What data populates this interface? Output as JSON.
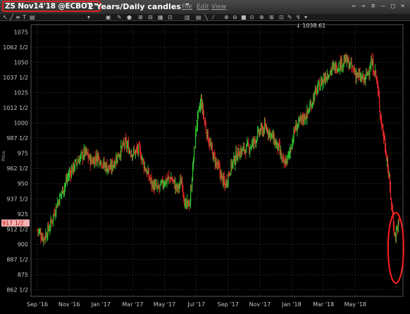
{
  "window": {
    "symbol": "ZS Nov14'18 @ECBOT",
    "period": "2 Years/Daily candles",
    "menus": [
      "File",
      "Edit",
      "View"
    ],
    "controls": [
      "←",
      "→",
      "≡",
      "—",
      "□",
      "×"
    ]
  },
  "toolbar": {
    "icons": [
      "cursor-icon",
      "line-tool-icon",
      "channel-tool-icon",
      "text-tool-icon",
      "fib-tool-icon",
      "snapshot-icon",
      "color-icon",
      "settings-icon",
      "indicator-icon",
      "compare-icon",
      "zoom-in-icon",
      "zoom-out-icon",
      "pan-icon",
      "crosshair-icon",
      "bar-type-icon",
      "layout-icon",
      "link-icon",
      "print-icon",
      "dropdown-icon"
    ]
  },
  "chart": {
    "y_label": "Price",
    "crosshair_readout": "1038.61",
    "last_price_label": "917 1/2",
    "colors": {
      "up": "#2ec02e",
      "down": "#e02828",
      "grid": "#3a3a3a",
      "last_price_bg": "#f3b3b3",
      "highlight": "#ff2020"
    }
  },
  "chart_data": {
    "type": "candlestick",
    "title": "ZS Nov14'18 @ECBOT",
    "xlabel": "",
    "ylabel": "Price",
    "y_ticks": [
      "1075",
      "1062 1/2",
      "1050",
      "1037 1/2",
      "1025",
      "1012 1/2",
      "1000",
      "987 1/2",
      "975",
      "962 1/2",
      "950",
      "937 1/2",
      "925",
      "912 1/2",
      "900",
      "887 1/2",
      "875",
      "862 1/2"
    ],
    "y_tick_values": [
      1075,
      1062.5,
      1050,
      1037.5,
      1025,
      1012.5,
      1000,
      987.5,
      975,
      962.5,
      950,
      937.5,
      925,
      912.5,
      900,
      887.5,
      875,
      862.5
    ],
    "ylim": [
      857,
      1081
    ],
    "x_ticks": [
      "Sep '16",
      "Nov '16",
      "Jan '17",
      "Mar '17",
      "May '17",
      "Jul '17",
      "Sep '17",
      "Nov '17",
      "Jan '18",
      "Mar '18",
      "May '18"
    ],
    "x_tick_months": [
      0,
      2,
      4,
      6,
      8,
      10,
      12,
      14,
      16,
      18,
      20
    ],
    "xlim_months": [
      -0.4,
      23.0
    ],
    "price_path": [
      [
        0.0,
        912
      ],
      [
        0.4,
        905
      ],
      [
        0.8,
        915
      ],
      [
        1.2,
        932
      ],
      [
        1.6,
        945
      ],
      [
        2.0,
        958
      ],
      [
        2.5,
        968
      ],
      [
        3.0,
        976
      ],
      [
        3.4,
        968
      ],
      [
        3.8,
        973
      ],
      [
        4.2,
        965
      ],
      [
        4.6,
        962
      ],
      [
        5.0,
        972
      ],
      [
        5.5,
        983
      ],
      [
        6.0,
        975
      ],
      [
        6.4,
        978
      ],
      [
        6.8,
        962
      ],
      [
        7.2,
        950
      ],
      [
        7.6,
        945
      ],
      [
        8.0,
        952
      ],
      [
        8.4,
        955
      ],
      [
        8.8,
        945
      ],
      [
        9.1,
        953
      ],
      [
        9.3,
        930
      ],
      [
        9.6,
        935
      ],
      [
        10.0,
        998
      ],
      [
        10.3,
        1018
      ],
      [
        10.6,
        995
      ],
      [
        11.0,
        975
      ],
      [
        11.4,
        962
      ],
      [
        11.8,
        948
      ],
      [
        12.2,
        965
      ],
      [
        12.6,
        975
      ],
      [
        13.0,
        978
      ],
      [
        13.5,
        982
      ],
      [
        14.0,
        993
      ],
      [
        14.4,
        996
      ],
      [
        14.8,
        988
      ],
      [
        15.2,
        978
      ],
      [
        15.5,
        965
      ],
      [
        15.8,
        972
      ],
      [
        16.2,
        995
      ],
      [
        16.6,
        1002
      ],
      [
        17.0,
        1008
      ],
      [
        17.4,
        1022
      ],
      [
        17.8,
        1032
      ],
      [
        18.2,
        1040
      ],
      [
        18.6,
        1045
      ],
      [
        19.0,
        1048
      ],
      [
        19.4,
        1052
      ],
      [
        19.8,
        1045
      ],
      [
        20.2,
        1038
      ],
      [
        20.6,
        1035
      ],
      [
        21.0,
        1050
      ],
      [
        21.3,
        1040
      ],
      [
        21.6,
        1005
      ],
      [
        22.0,
        970
      ],
      [
        22.3,
        930
      ],
      [
        22.5,
        905
      ],
      [
        22.65,
        915
      ],
      [
        22.75,
        917.5
      ]
    ],
    "last_price": 917.5,
    "crosshair_value": 1038.61
  }
}
